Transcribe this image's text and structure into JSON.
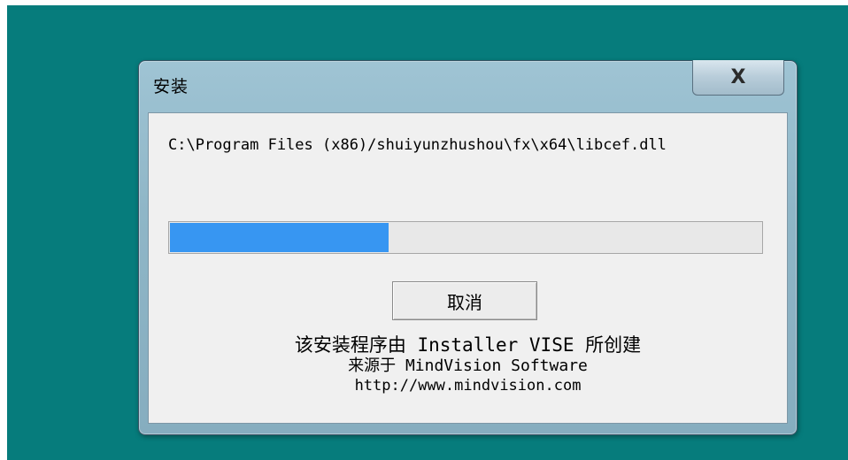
{
  "window": {
    "title": "安装",
    "close_glyph": "X"
  },
  "install": {
    "current_file": "C:\\Program Files (x86)/shuiyunzhushou\\fx\\x64\\libcef.dll",
    "progress_percent": 37
  },
  "buttons": {
    "cancel_label": "取消"
  },
  "credits": {
    "line1": "该安装程序由 Installer VISE 所创建",
    "line2": "来源于 MindVision Software",
    "line3": "http://www.mindvision.com"
  },
  "colors": {
    "desktop": "#067c7c",
    "progress_fill": "#3796f2"
  }
}
